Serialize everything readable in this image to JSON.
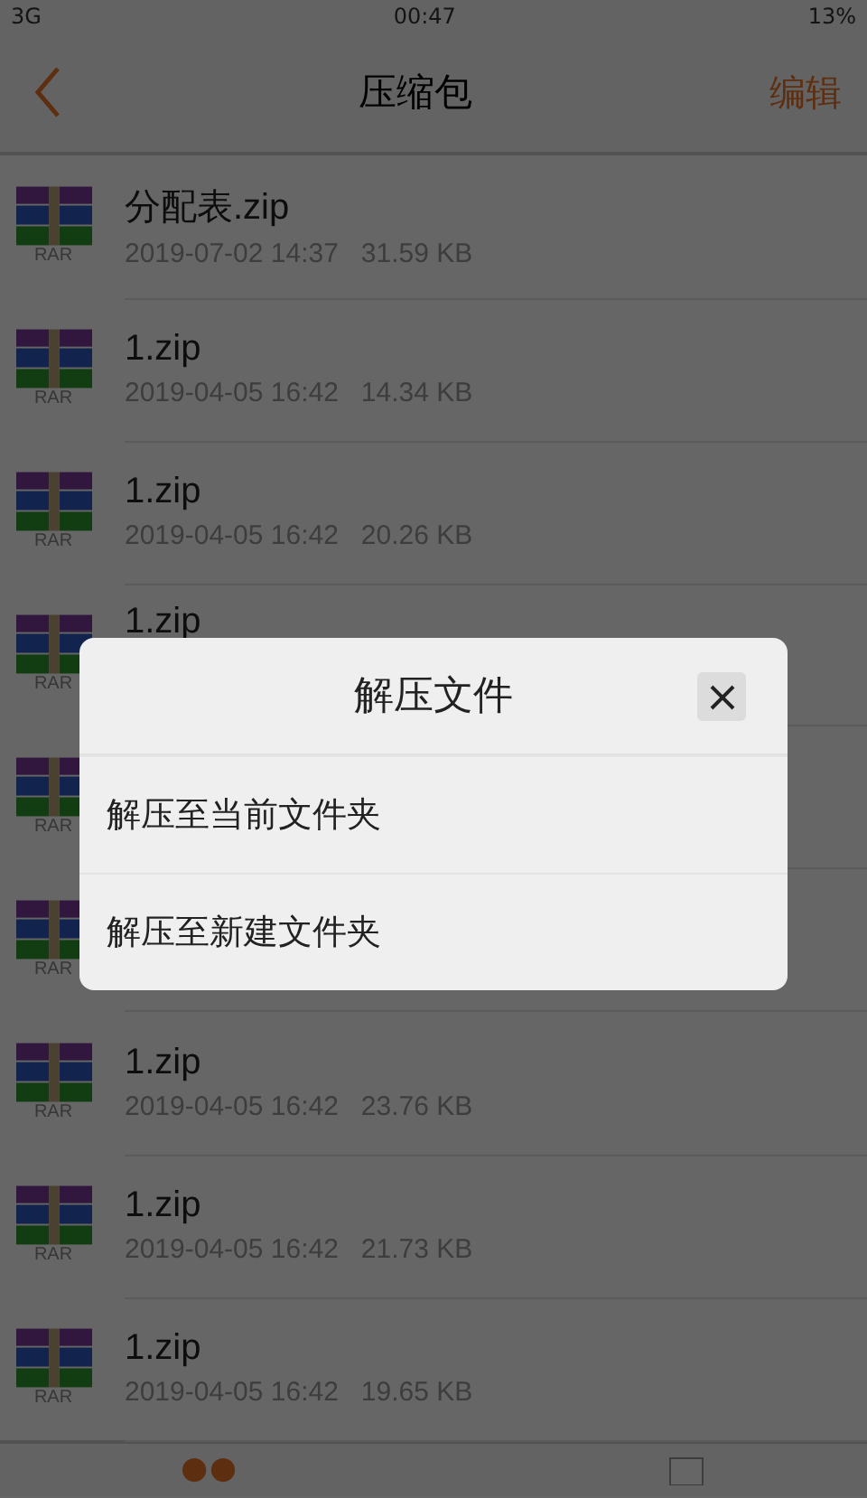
{
  "status_bar": {
    "network": "3G",
    "time": "00:47",
    "battery": "13%"
  },
  "nav": {
    "title": "压缩包",
    "action": "编辑"
  },
  "files": [
    {
      "badge": "RAR",
      "name": "分配表.zip",
      "date": "2019-07-02 14:37",
      "size": "31.59 KB"
    },
    {
      "badge": "RAR",
      "name": "1.zip",
      "date": "2019-04-05 16:42",
      "size": "14.34 KB"
    },
    {
      "badge": "RAR",
      "name": "1.zip",
      "date": "2019-04-05 16:42",
      "size": "20.26 KB"
    },
    {
      "badge": "RAR",
      "name": "1.zip"
    },
    {
      "badge": "RAR"
    },
    {
      "badge": "RAR"
    },
    {
      "badge": "RAR",
      "name": "1.zip",
      "date": "2019-04-05 16:42",
      "size": "23.76 KB"
    },
    {
      "badge": "RAR",
      "name": "1.zip",
      "date": "2019-04-05 16:42",
      "size": "21.73 KB"
    },
    {
      "badge": "RAR",
      "name": "1.zip",
      "date": "2019-04-05 16:42",
      "size": "19.65 KB"
    }
  ],
  "dialog": {
    "title": "解压文件",
    "options": [
      "解压至当前文件夹",
      "解压至新建文件夹"
    ]
  }
}
